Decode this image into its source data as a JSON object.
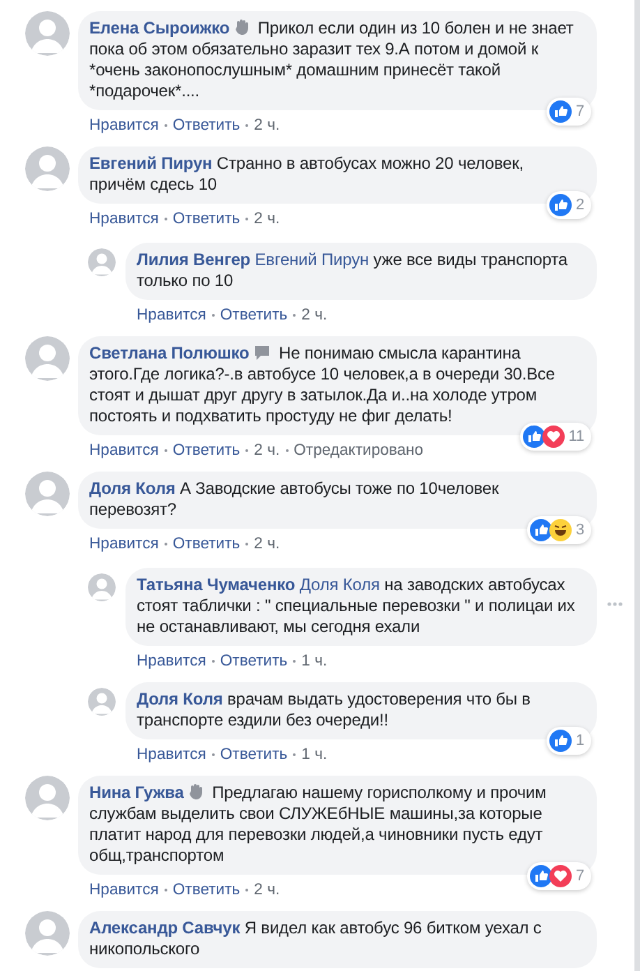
{
  "comments": [
    {
      "author": "Елена Сыроижко",
      "badge": {
        "kind": "hand"
      },
      "text": "Прикол если один из 10 болен и не знает пока об этом обязательно заразит тех 9.А потом и домой к *очень законопослушным* домашним принесёт такой *подарочек*....",
      "reactions": {
        "icons": [
          {
            "kind": "like"
          }
        ],
        "count": "7"
      },
      "actions": [
        "Нравится",
        "Ответить",
        "2 ч."
      ]
    },
    {
      "author": "Евгений Пирун",
      "text": "Странно в автобусах можно 20 человек, причём сдесь 10",
      "reactions": {
        "icons": [
          {
            "kind": "like"
          }
        ],
        "count": "2"
      },
      "actions": [
        "Нравится",
        "Ответить",
        "2 ч."
      ],
      "children": [
        {
          "author": "Лилия Венгер",
          "mention": "Евгений Пирун",
          "text": "уже все виды транспорта только по 10",
          "actions": [
            "Нравится",
            "Ответить",
            "2 ч."
          ]
        }
      ]
    },
    {
      "author": "Светлана Полюшко",
      "badge": {
        "kind": "chat"
      },
      "text": "Не понимаю смысла карантина этого.Где логика?-.в автобусе 10 человек,а в очереди 30.Все стоят и дышат друг другу в затылок.Да и..на холоде утром постоять и подхватить простуду не фиг делать!",
      "reactions": {
        "icons": [
          {
            "kind": "like"
          },
          {
            "kind": "love"
          }
        ],
        "count": "11"
      },
      "actions": [
        "Нравится",
        "Ответить",
        "2 ч.",
        "Отредактировано"
      ]
    },
    {
      "author": "Доля Коля",
      "text": "А Заводские автобусы тоже по 10человек перевозят?",
      "reactions": {
        "icons": [
          {
            "kind": "like"
          },
          {
            "kind": "haha"
          }
        ],
        "count": "3"
      },
      "actions": [
        "Нравится",
        "Ответить",
        "2 ч."
      ],
      "children": [
        {
          "author": "Татьяна Чумаченко",
          "mention": "Доля Коля",
          "text": "на заводских автобусах стоят таблички : \" специальные перевозки \" и полицаи их не останавливают, мы сегодня ехали",
          "actions": [
            "Нравится",
            "Ответить",
            "1 ч."
          ],
          "show_more": true
        },
        {
          "author": "Доля Коля",
          "text": "врачам выдать удостоверения что бы в транспорте ездили без очереди!!",
          "reactions": {
            "icons": [
              {
                "kind": "like"
              }
            ],
            "count": "1"
          },
          "actions": [
            "Нравится",
            "Ответить",
            "1 ч."
          ]
        }
      ]
    },
    {
      "author": "Нина Гужва",
      "badge": {
        "kind": "hand"
      },
      "text": "Предлагаю нашему горисполкому и прочим службам выделить свои СЛУЖЕбНЫЕ машины,за которые платит народ для перевозки людей,а чиновники пусть едут общ,транспортом",
      "reactions": {
        "icons": [
          {
            "kind": "like"
          },
          {
            "kind": "love"
          }
        ],
        "count": "7"
      },
      "actions": [
        "Нравится",
        "Ответить",
        "2 ч."
      ]
    },
    {
      "author": "Александр Савчук",
      "text": "Я видел как автобус 96 битком уехал с никопольского"
    }
  ]
}
